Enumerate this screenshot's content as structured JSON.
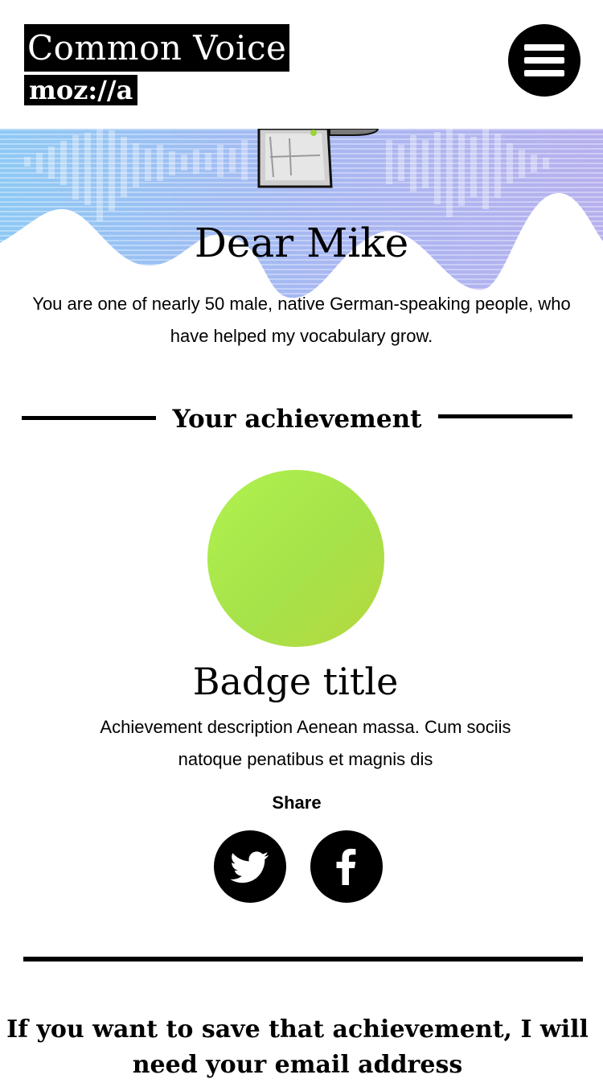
{
  "header": {
    "app_title": "Common Voice",
    "brand": "moz://a",
    "menu_icon": "hamburger-menu-icon"
  },
  "hero": {
    "greeting": "Dear Mike",
    "message": "You are one of nearly 50 male, native German-speaking people, who have helped my vocabulary grow."
  },
  "achievement": {
    "section_title": "Your achievement",
    "badge_title": "Badge title",
    "badge_description": "Achievement description Aenean massa. Cum sociis natoque penatibus et magnis dis",
    "badge_colors": [
      "#b0f24e",
      "#b6d83e"
    ],
    "share_label": "Share",
    "share_icons": [
      "twitter-icon",
      "facebook-icon"
    ]
  },
  "cta": {
    "text": "If you want to save that achievement, I will need your email address"
  },
  "colors": {
    "accent": "#000000",
    "wave_gradient_start": "#8ec9f5",
    "wave_gradient_end": "#b7b0ee"
  }
}
